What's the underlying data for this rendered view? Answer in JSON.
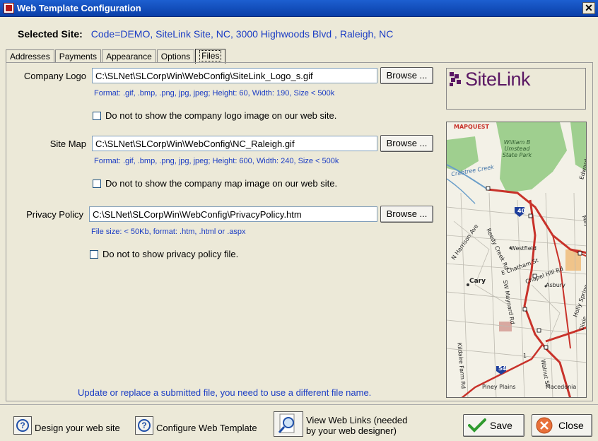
{
  "window": {
    "title": "Web Template Configuration",
    "close_glyph": "✕"
  },
  "selected_site": {
    "label": "Selected Site:",
    "value": "Code=DEMO,  SiteLink Site, NC, 3000 Highwoods Blvd , Raleigh, NC"
  },
  "tabs": [
    {
      "label": "Addresses"
    },
    {
      "label": "Payments"
    },
    {
      "label": "Appearance"
    },
    {
      "label": "Options"
    },
    {
      "label": "Files",
      "active": true
    }
  ],
  "company_logo": {
    "label": "Company Logo",
    "value": "C:\\SLNet\\SLCorpWin\\WebConfig\\SiteLink_Logo_s.gif",
    "browse_label": "Browse ...",
    "hint": "Format: .gif, .bmp, .png, jpg, jpeg; Height: 60, Width: 190, Size < 500k",
    "checkbox_label": "Do not to show the company logo image on our web site."
  },
  "site_map": {
    "label": "Site Map",
    "value": "C:\\SLNet\\SLCorpWin\\WebConfig\\NC_Raleigh.gif",
    "browse_label": "Browse ...",
    "hint": "Format: .gif, .bmp, .png, jpg, jpeg; Height: 600, Width: 240, Size < 500k",
    "checkbox_label": "Do not to show the company map image on our web site."
  },
  "privacy_policy": {
    "label": "Privacy Policy",
    "value": "C:\\SLNet\\SLCorpWin\\WebConfig\\PrivacyPolicy.htm",
    "browse_label": "Browse ...",
    "hint": "File size: < 50Kb, format: .htm, .html or .aspx",
    "checkbox_label": "Do not to show privacy policy file."
  },
  "logo_preview": {
    "text": "SiteLink",
    "color": "#5a1763"
  },
  "map_preview": {
    "labels": {
      "brand": "MAPQUEST",
      "park": "William B Umstead State Park",
      "creek": "Crabtree Creek",
      "interstate": "40",
      "street1": "N Harrison Ave",
      "street2": "Reedy Creek Rd",
      "street3": "Chapel Hill Rd",
      "street4": "Maynard Rd",
      "place1": "Westfield",
      "place2": "Asbury",
      "place3": "Cary",
      "street5": "E Chatham St",
      "street6": "SW Maynard Rd",
      "street7": "Holly Springs Rd",
      "street8": "Walnut St",
      "street9": "Kildaire Farm Rd",
      "place4": "Piney Plains",
      "place5": "Macedonia",
      "route": "54",
      "route2": "1",
      "edge1": "Edwards",
      "edge2": "Dixie"
    }
  },
  "footer_note": "Update or replace a submitted file, you need to use a different file name.",
  "bottom": {
    "design_label": "Design your web site",
    "configure_label": "Configure Web Template",
    "view_links_label": "View Web Links (needed by your web designer)",
    "save_label": "Save",
    "close_label": "Close"
  }
}
